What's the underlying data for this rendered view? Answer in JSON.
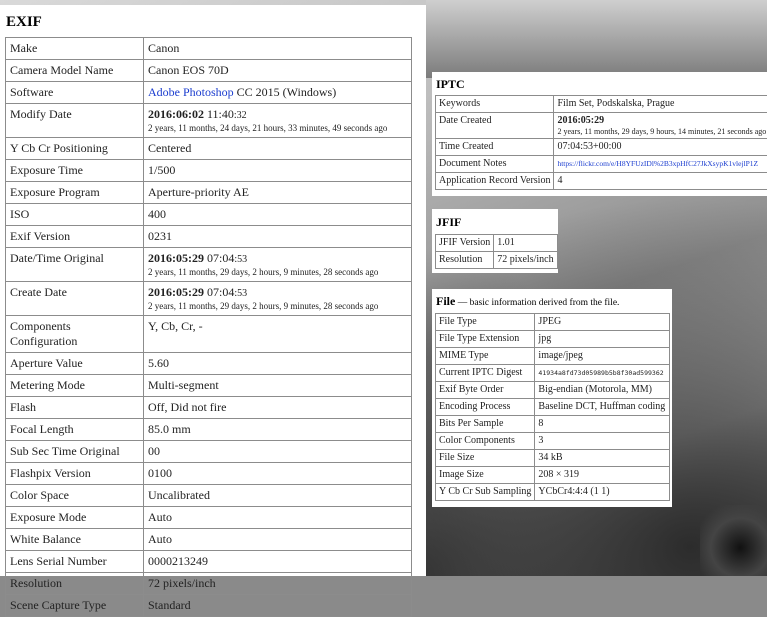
{
  "exif": {
    "title": "EXIF",
    "rows": [
      {
        "label": "Make",
        "value": "Canon"
      },
      {
        "label": "Camera Model Name",
        "value": "Canon EOS 70D"
      },
      {
        "label": "Software",
        "value_link": "Adobe Photoshop",
        "value_rest": " CC 2015 (Windows)"
      },
      {
        "label": "Modify Date",
        "date": "2016:06:02",
        "time_hm": " 11:40",
        "time_s": ":32",
        "ago": "2 years, 11 months, 24 days, 21 hours, 33 minutes, 49 seconds ago"
      },
      {
        "label": "Y Cb Cr Positioning",
        "value": "Centered"
      },
      {
        "label": "Exposure Time",
        "value": "1/500"
      },
      {
        "label": "Exposure Program",
        "value": "Aperture-priority AE"
      },
      {
        "label": "ISO",
        "value": "400"
      },
      {
        "label": "Exif Version",
        "value": "0231"
      },
      {
        "label": "Date/Time Original",
        "date": "2016:05:29",
        "time_hm": " 07:04",
        "time_s": ":53",
        "ago": "2 years, 11 months, 29 days, 2 hours, 9 minutes, 28 seconds ago"
      },
      {
        "label": "Create Date",
        "date": "2016:05:29",
        "time_hm": " 07:04",
        "time_s": ":53",
        "ago": "2 years, 11 months, 29 days, 2 hours, 9 minutes, 28 seconds ago"
      },
      {
        "label": "Components Configuration",
        "value": "Y, Cb, Cr, -"
      },
      {
        "label": "Aperture Value",
        "value": "5.60"
      },
      {
        "label": "Metering Mode",
        "value": "Multi-segment"
      },
      {
        "label": "Flash",
        "value": "Off, Did not fire"
      },
      {
        "label": "Focal Length",
        "value": "85.0 mm"
      },
      {
        "label": "Sub Sec Time Original",
        "value": "00"
      },
      {
        "label": "Flashpix Version",
        "value": "0100"
      },
      {
        "label": "Color Space",
        "value": "Uncalibrated"
      },
      {
        "label": "Exposure Mode",
        "value": "Auto"
      },
      {
        "label": "White Balance",
        "value": "Auto"
      },
      {
        "label": "Lens Serial Number",
        "value": "0000213249"
      },
      {
        "label": "Resolution",
        "value": "72 pixels/inch"
      },
      {
        "label": "Scene Capture Type",
        "value": "Standard"
      }
    ]
  },
  "iptc": {
    "title": "IPTC",
    "rows": [
      {
        "label": "Keywords",
        "value": "Film Set, Podskalska, Prague"
      },
      {
        "label": "Date Created",
        "date": "2016:05:29",
        "ago": "2 years, 11 months, 29 days, 9 hours, 14 minutes, 21 seconds ago"
      },
      {
        "label": "Time Created",
        "value": "07:04:53+00:00"
      },
      {
        "label": "Document Notes",
        "link": "https://flickr.com/e/H8YFUzIDl%2B3xpHfC27JkXsypK1vlejlP1Z"
      },
      {
        "label": "Application Record Version",
        "value": "4"
      }
    ]
  },
  "jfif": {
    "title": "JFIF",
    "rows": [
      {
        "label": "JFIF Version",
        "value": "1.01"
      },
      {
        "label": "Resolution",
        "value": "72 pixels/inch"
      }
    ]
  },
  "file": {
    "title": "File",
    "desc": " — basic information derived from the file.",
    "rows": [
      {
        "label": "File Type",
        "value": "JPEG"
      },
      {
        "label": "File Type Extension",
        "value": "jpg"
      },
      {
        "label": "MIME Type",
        "value": "image/jpeg"
      },
      {
        "label": "Current IPTC Digest",
        "value": "41934a8fd73d05989b5b8f30ad599362"
      },
      {
        "label": "Exif Byte Order",
        "value": "Big-endian (Motorola, MM)"
      },
      {
        "label": "Encoding Process",
        "value": "Baseline DCT, Huffman coding"
      },
      {
        "label": "Bits Per Sample",
        "value": "8"
      },
      {
        "label": "Color Components",
        "value": "3"
      },
      {
        "label": "File Size",
        "value": "34 kB"
      },
      {
        "label": "Image Size",
        "value": "208 × 319"
      },
      {
        "label": "Y Cb Cr Sub Sampling",
        "value": "YCbCr4:4:4 (1 1)"
      }
    ]
  }
}
